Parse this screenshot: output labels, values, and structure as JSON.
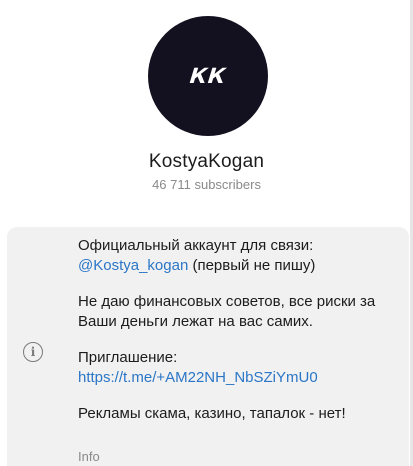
{
  "channel": {
    "avatar_text": "КК",
    "name": "KostyaKogan",
    "subscribers": "46 711 subscribers"
  },
  "about": {
    "line1": "Официальный аккаунт для связи:",
    "handle": "@Kostya_kogan",
    "handle_note": " (первый не пишу)",
    "para2": "Не даю финансовых советов, все риски за Ваши деньги лежат на вас самих.",
    "invite_label": "Приглашение:",
    "invite_link": "https://t.me/+AM22NH_NbSZiYmU0",
    "para4": "Рекламы скама, казино, тапалок - нет!"
  },
  "info_label": "Info",
  "colors": {
    "avatar_bg": "#13111f",
    "link": "#2b76c7",
    "card_bg": "#f1f1f1"
  },
  "icons": {
    "info": "info-icon"
  }
}
